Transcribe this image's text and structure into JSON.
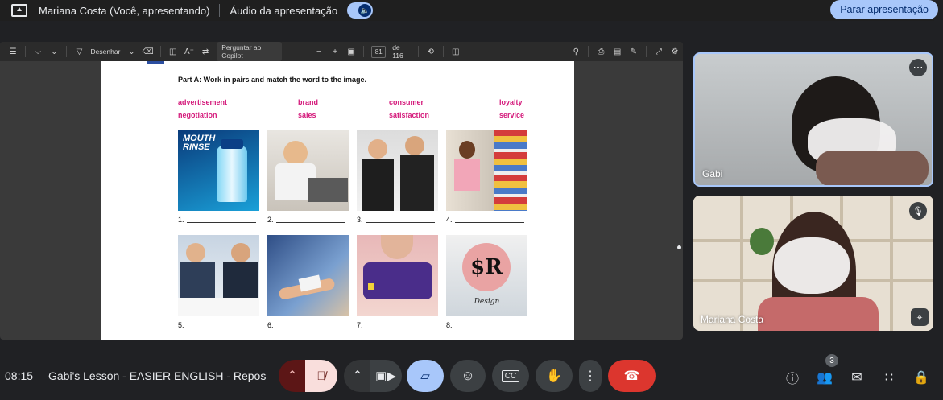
{
  "topbar": {
    "presenter": "Mariana Costa (Você, apresentando)",
    "audio_label": "Áudio da apresentação",
    "stop_button": "Parar apresentação"
  },
  "pdf_toolbar": {
    "draw_label": "Desenhar",
    "copilot_label": "Perguntar ao Copilot",
    "page_current": "81",
    "page_total": "de 116"
  },
  "page": {
    "instruction": "Part A: Work in pairs and match the word to the image.",
    "words": [
      "advertisement",
      "brand",
      "consumer",
      "loyalty",
      "negotiation",
      "sales",
      "satisfaction",
      "service"
    ],
    "numbers": [
      "1.",
      "2.",
      "3.",
      "4.",
      "5.",
      "6.",
      "7.",
      "8."
    ],
    "mouth_rinse_text": "MOUTH RINSE",
    "logo_text": "$R",
    "design_text": "Design"
  },
  "tiles": {
    "gabi_name": "Gabi",
    "mariana_name": "Mariana Costa"
  },
  "bottombar": {
    "time": "08:15",
    "meeting_title": "Gabi's Lesson - EASIER ENGLISH - Reposição",
    "participants_count": "3"
  },
  "colors": {
    "accent": "#a8c7fa",
    "end_call": "#dc362e",
    "keyword": "#d4187a"
  }
}
